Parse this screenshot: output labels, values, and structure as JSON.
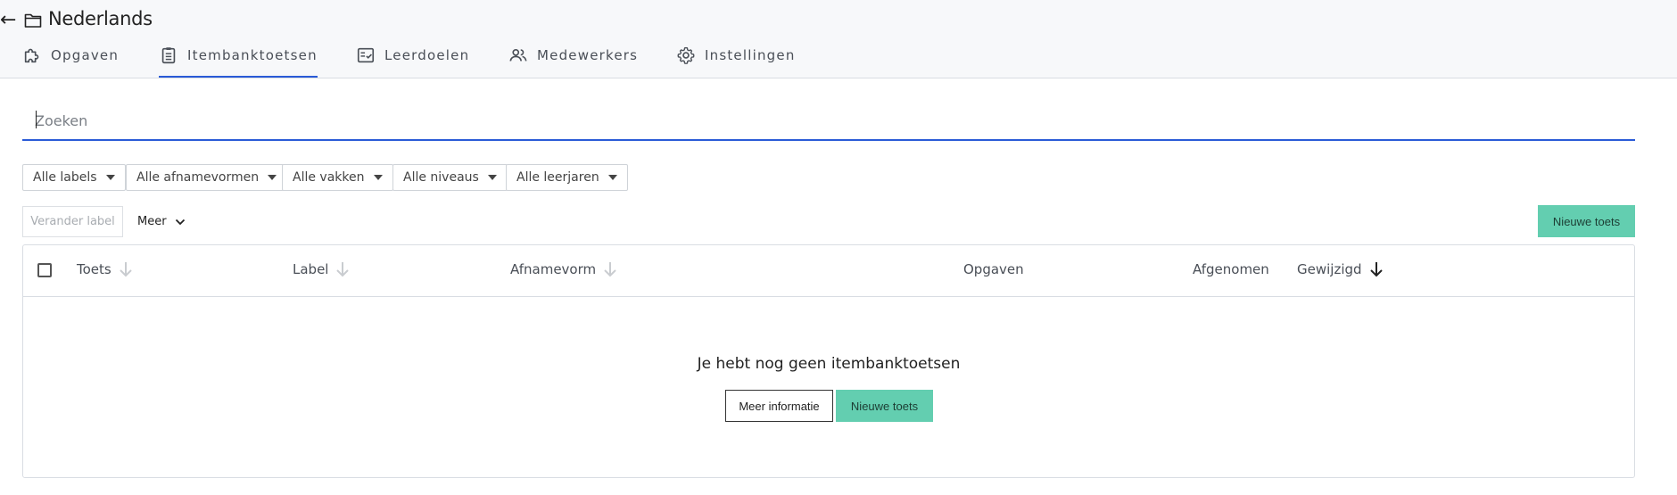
{
  "header": {
    "back_icon": "arrow-left-icon",
    "folder_icon": "folder-icon",
    "title": "Nederlands",
    "tabs": [
      {
        "label": "Opgaven",
        "icon": "puzzle-icon"
      },
      {
        "label": "Itembanktoetsen",
        "icon": "clipboard-icon",
        "active": true
      },
      {
        "label": "Leerdoelen",
        "icon": "checklist-icon"
      },
      {
        "label": "Medewerkers",
        "icon": "people-icon"
      },
      {
        "label": "Instellingen",
        "icon": "gear-icon"
      }
    ]
  },
  "search": {
    "placeholder": "Zoeken",
    "value": ""
  },
  "filters": [
    "Alle labels",
    "Alle afnamevormen",
    "Alle vakken",
    "Alle niveaus",
    "Alle leerjaren"
  ],
  "toolbar": {
    "change_label": "Verander label",
    "more": "Meer",
    "new_test": "Nieuwe toets"
  },
  "table": {
    "columns": [
      "Toets",
      "Label",
      "Afnamevorm",
      "Opgaven",
      "Afgenomen",
      "Gewijzigd"
    ],
    "sorted_column": "Gewijzigd",
    "empty_message": "Je hebt nog geen itembanktoetsen",
    "more_info": "Meer informatie",
    "new_test": "Nieuwe toets"
  },
  "colors": {
    "accent": "#2a5bd7",
    "green": "#63ceb0"
  }
}
